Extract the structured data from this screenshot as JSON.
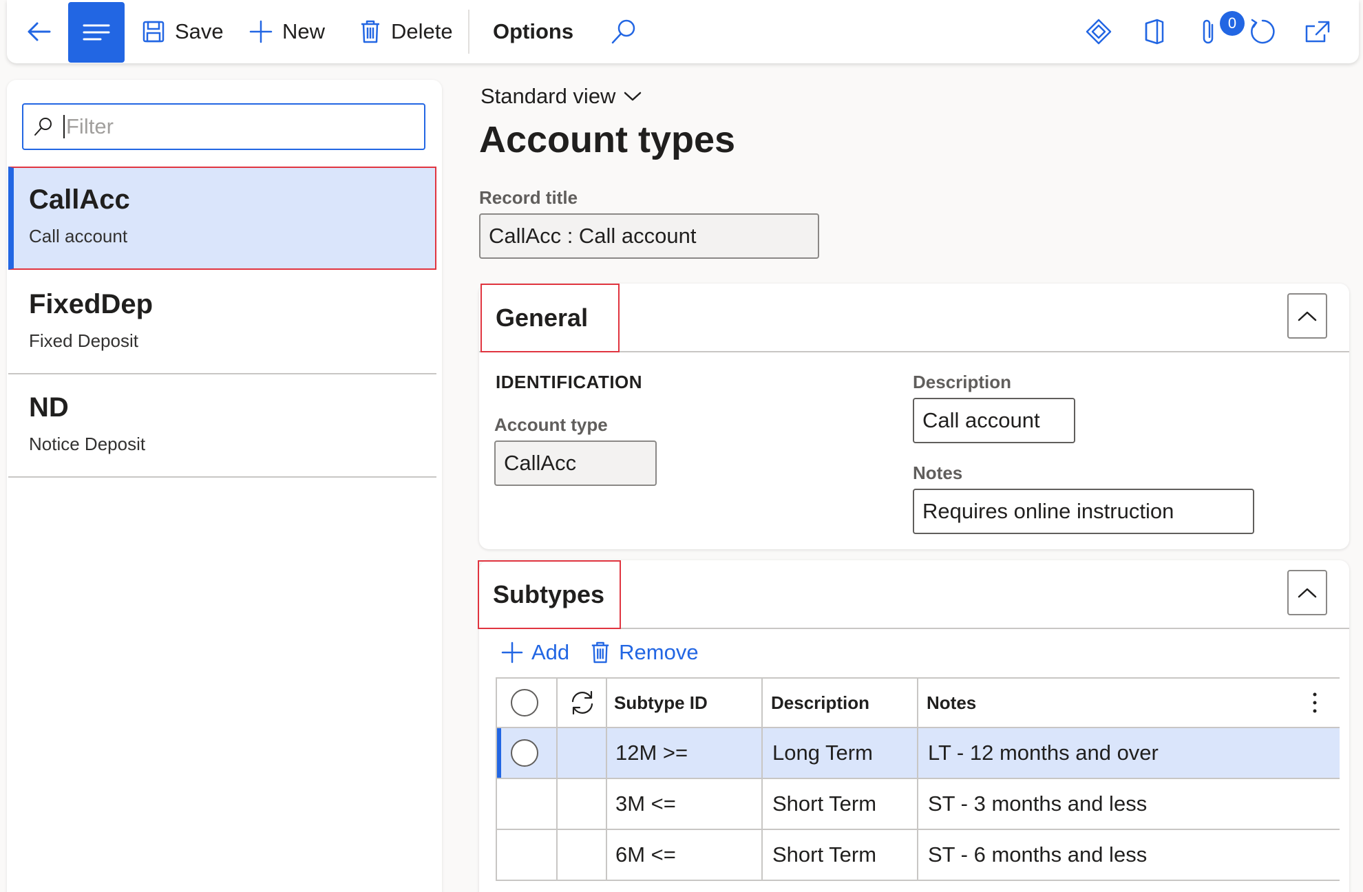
{
  "toolbar": {
    "save_label": "Save",
    "new_label": "New",
    "delete_label": "Delete",
    "options_label": "Options",
    "attachments_count": "0"
  },
  "left": {
    "filter_placeholder": "Filter",
    "items": [
      {
        "title": "CallAcc",
        "subtitle": "Call account",
        "selected": true
      },
      {
        "title": "FixedDep",
        "subtitle": "Fixed Deposit",
        "selected": false
      },
      {
        "title": "ND",
        "subtitle": "Notice Deposit",
        "selected": false
      }
    ]
  },
  "main": {
    "view_name": "Standard view",
    "page_title": "Account types",
    "record_title_label": "Record title",
    "record_title_value": "CallAcc : Call account",
    "general": {
      "title": "General",
      "group_title": "IDENTIFICATION",
      "account_type_label": "Account type",
      "account_type_value": "CallAcc",
      "description_label": "Description",
      "description_value": "Call account",
      "notes_label": "Notes",
      "notes_value": "Requires online instruction"
    },
    "subtypes": {
      "title": "Subtypes",
      "add_label": "Add",
      "remove_label": "Remove",
      "columns": [
        "Subtype ID",
        "Description",
        "Notes"
      ],
      "rows": [
        {
          "id": "12M >=",
          "description": "Long Term",
          "notes": "LT - 12 months and over",
          "selected": true
        },
        {
          "id": "3M <=",
          "description": "Short Term",
          "notes": "ST - 3 months and less",
          "selected": false
        },
        {
          "id": "6M <=",
          "description": "Short Term",
          "notes": "ST - 6 months and less",
          "selected": false
        }
      ]
    }
  },
  "colors": {
    "accent": "#2266e3",
    "selection": "#dae5fb",
    "highlight_border": "#e0343f"
  }
}
